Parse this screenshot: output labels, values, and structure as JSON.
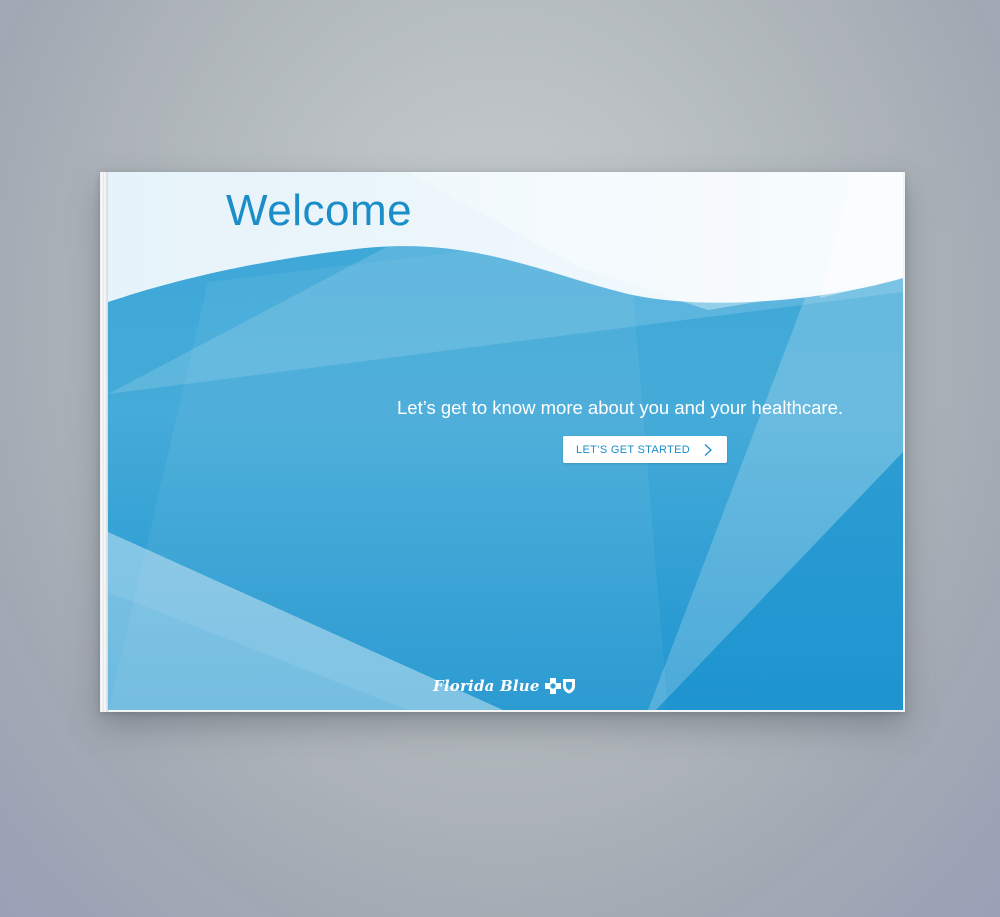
{
  "card": {
    "title": "Welcome",
    "tagline": "Let’s get to know more about you and your healthcare.",
    "cta_label": "LET’S GET STARTED",
    "brand": "Florida Blue"
  },
  "colors": {
    "accent": "#1b8dc9",
    "panel_blue": "#2a9fd3",
    "light_top": "#e9f5fb",
    "background": "#b3babd"
  },
  "icons": [
    "chevron-right-icon",
    "blue-cross-icon",
    "blue-shield-icon"
  ]
}
